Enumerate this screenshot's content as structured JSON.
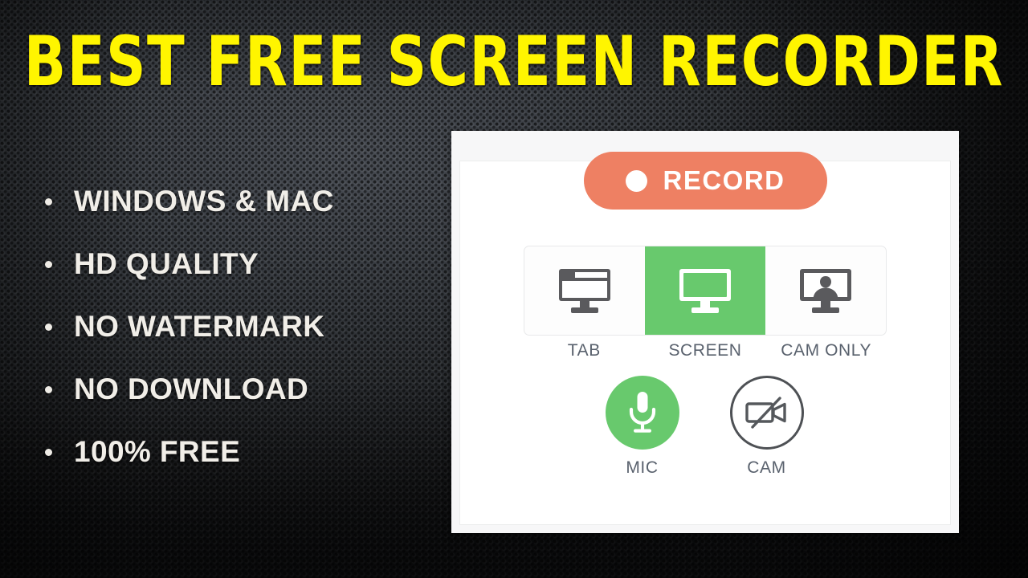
{
  "slide": {
    "title": "BEST FREE SCREEN RECORDER",
    "title_color": "#FFF500",
    "background_color": "#2c2f33",
    "bullet_text_color": "#f1eee8"
  },
  "bullets": [
    {
      "label": "WINDOWS & MAC",
      "bullet_icon": "bullet-dot-icon"
    },
    {
      "label": "HD QUALITY",
      "bullet_icon": "bullet-dot-icon"
    },
    {
      "label": "NO WATERMARK",
      "bullet_icon": "bullet-dot-icon"
    },
    {
      "label": "NO DOWNLOAD",
      "bullet_icon": "bullet-dot-icon"
    },
    {
      "label": "100% FREE",
      "bullet_icon": "bullet-dot-icon"
    }
  ],
  "recorder": {
    "record_button": {
      "label": "RECORD",
      "icon": "record-dot-icon",
      "color": "#ee8063",
      "text_color": "#ffffff"
    },
    "modes": [
      {
        "label": "TAB",
        "icon": "browser-tab-monitor-icon",
        "selected": false,
        "icon_color": "#5a5a5d"
      },
      {
        "label": "SCREEN",
        "icon": "monitor-icon",
        "selected": true,
        "icon_color": "#ffffff"
      },
      {
        "label": "CAM ONLY",
        "icon": "monitor-person-icon",
        "selected": false,
        "icon_color": "#5a5a5d"
      }
    ],
    "selected_mode": "SCREEN",
    "selected_color": "#68c96d",
    "label_color": "#59616d",
    "devices": [
      {
        "label": "MIC",
        "icon": "microphone-icon",
        "state": "on",
        "color": "#68c96d"
      },
      {
        "label": "CAM",
        "icon": "video-camera-off-icon",
        "state": "off",
        "color": "#4e5155"
      }
    ],
    "panel_bg": "#f7f7f8",
    "card_bg": "#ffffff"
  }
}
